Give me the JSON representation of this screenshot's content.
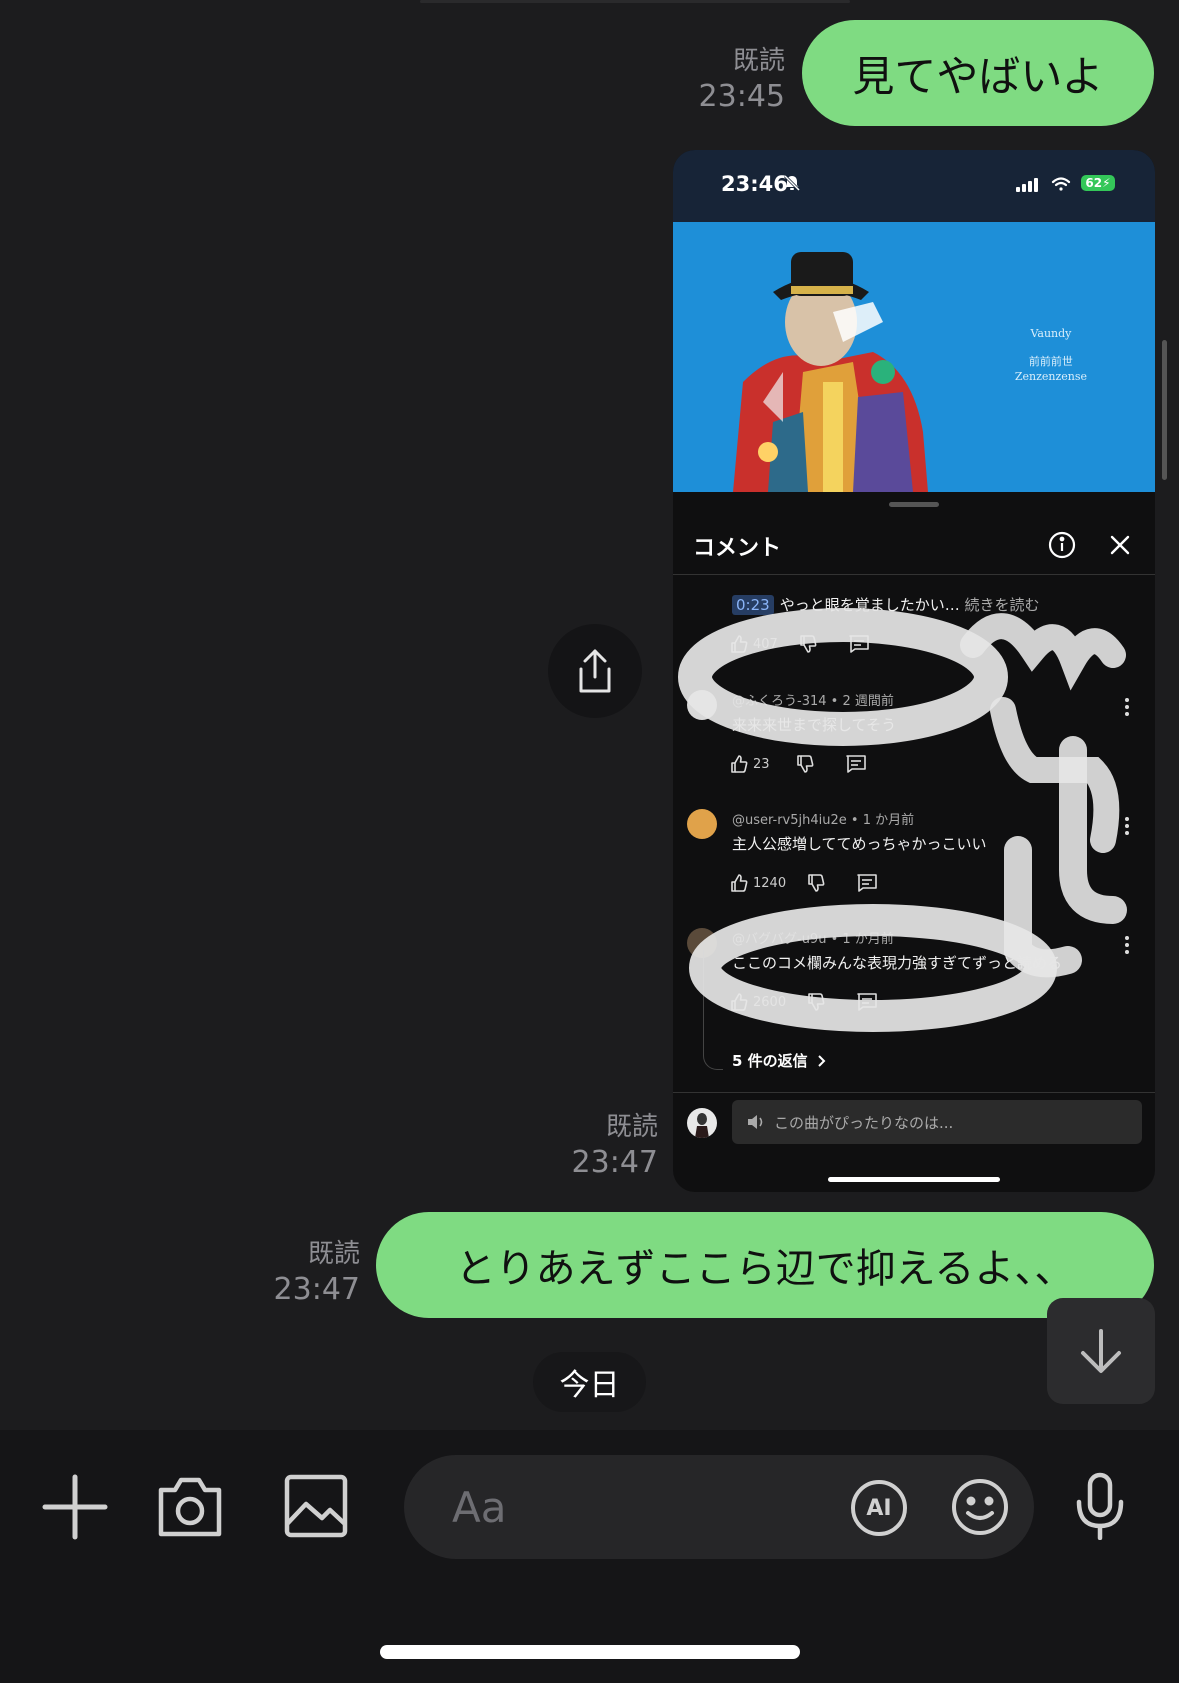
{
  "messages": [
    {
      "text": "見てやばいよ",
      "read_label": "既読",
      "time": "23:45"
    },
    {
      "read_label": "既読",
      "time": "23:47"
    },
    {
      "text": "とりあえずここら辺で抑えるよ、、",
      "read_label": "既読",
      "time": "23:47"
    }
  ],
  "screenshot": {
    "status_time": "23:46",
    "battery": "62",
    "album": {
      "artist": "Vaundy",
      "title_jp": "前前前世",
      "title_en": "Zenzenzense"
    },
    "comments_title": "コメント",
    "comments": [
      {
        "timestamp": "0:23",
        "text": "やっと眼を覚ましたかい…",
        "read_more": "続きを読む",
        "likes": "407"
      },
      {
        "author": "@ふくろう-314",
        "ago": "2 週間前",
        "text": "来来来世まで探してそう",
        "likes": "23"
      },
      {
        "author": "@user-rv5jh4iu2e",
        "ago": "1 か月前",
        "text": "主人公感増しててめっちゃかっこいい",
        "likes": "1240"
      },
      {
        "author": "@バグバグ-u9u",
        "ago": "1 か月前",
        "text": "ここのコメ欄みんな表現力強すぎてずっと読める",
        "likes": "2600"
      }
    ],
    "replies": "5 件の返信",
    "input_placeholder": "この曲がぴったりなのは..."
  },
  "date_chip": "今日",
  "composer": {
    "placeholder": "Aa",
    "ai_label": "AI"
  },
  "colors": {
    "bubble": "#7fdb82",
    "background": "#1c1c1e",
    "album_bg": "#1e8fd8"
  }
}
